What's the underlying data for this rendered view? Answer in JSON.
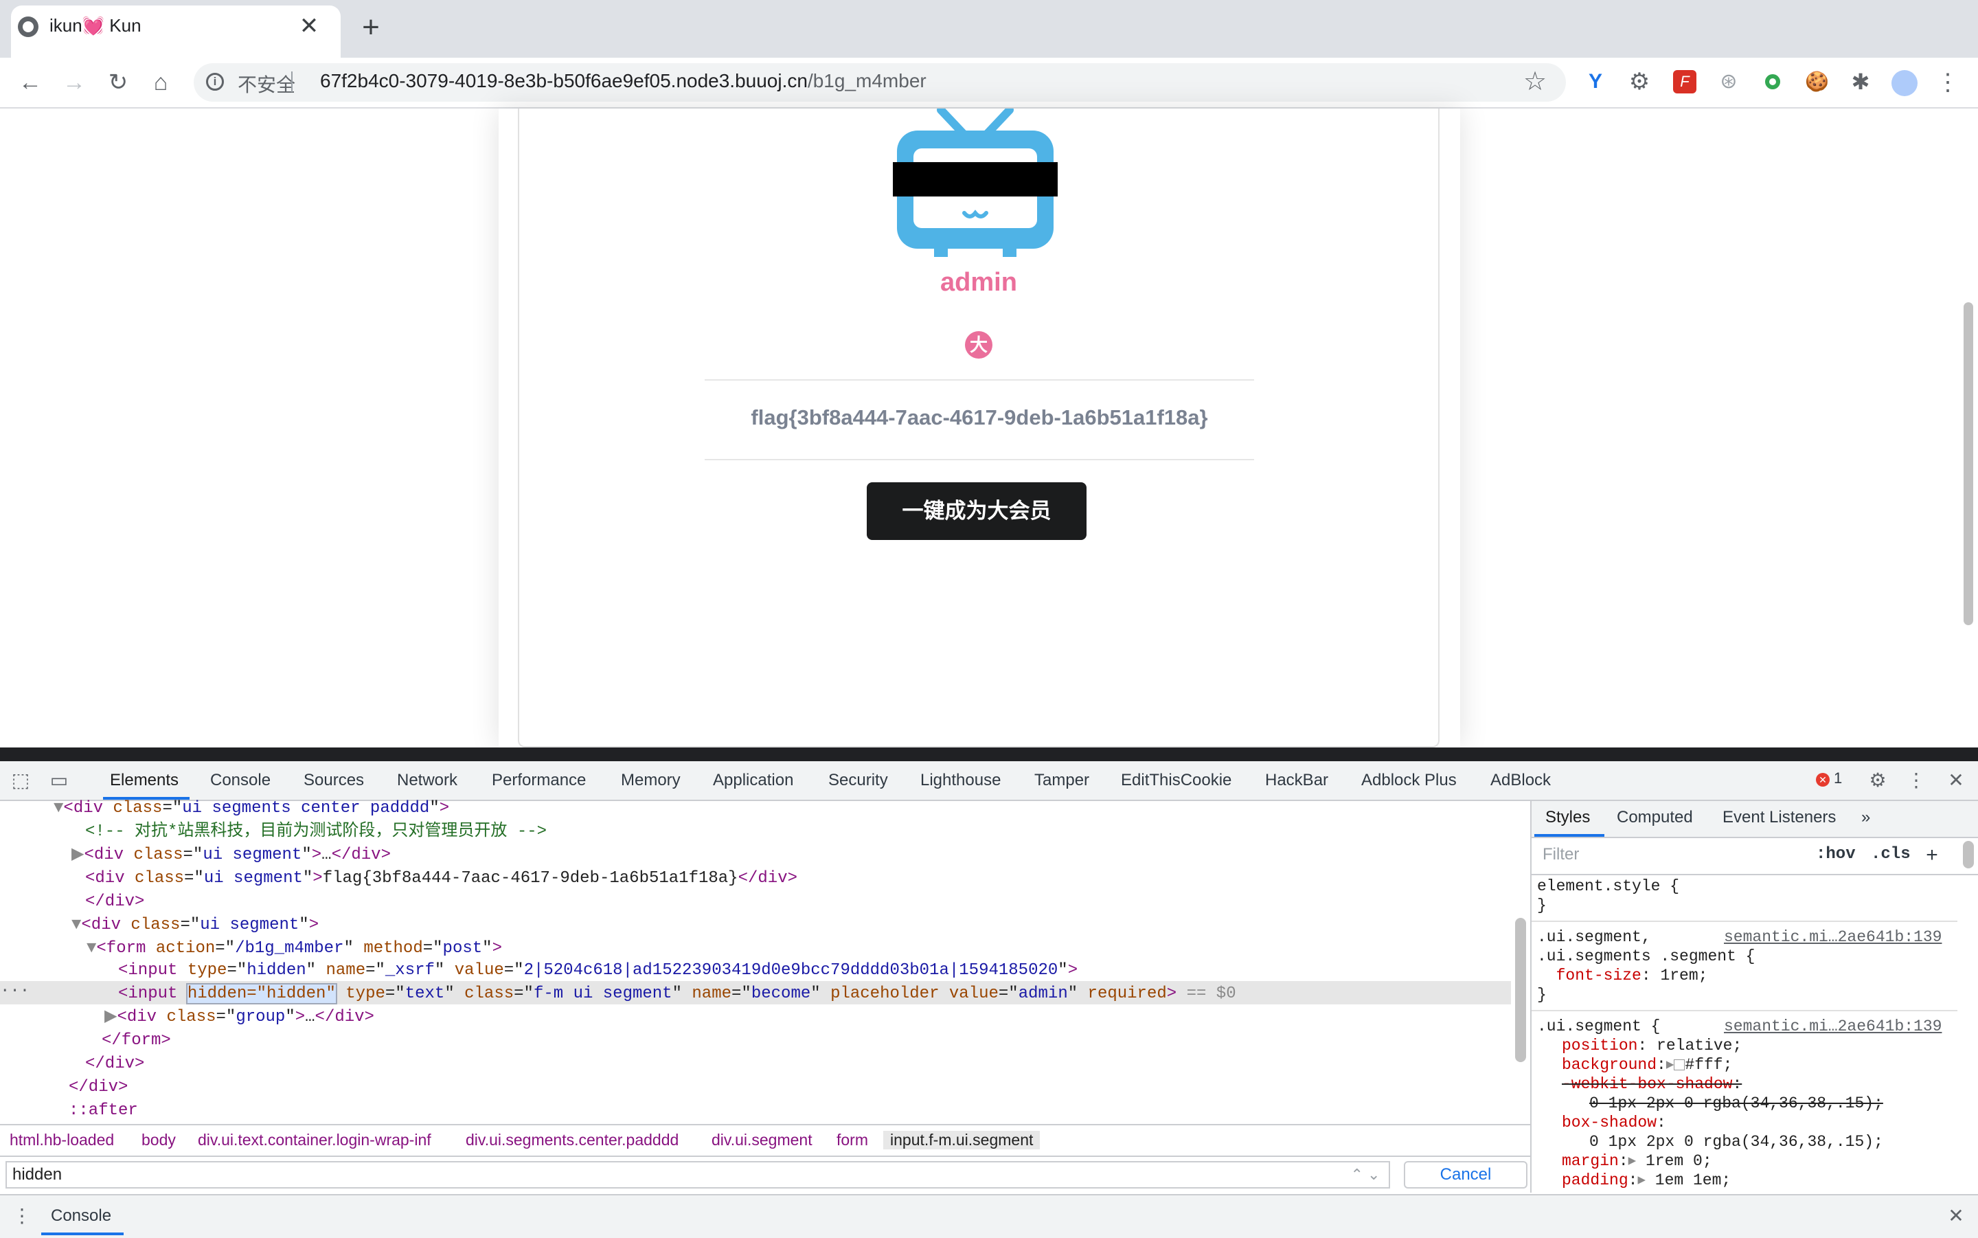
{
  "browser": {
    "tab_title": "ikun💓 Kun",
    "tab_close": "✕",
    "new_tab": "+",
    "insecure_label": "不安全",
    "url_host": "67f2b4c0-3079-4019-8e3b-b50f6ae9ef05.node3.buuoj.cn",
    "url_path": "/b1g_m4mber"
  },
  "page": {
    "username": "admin",
    "vip_badge": "大",
    "flag": "flag{3bf8a444-7aac-4617-9deb-1a6b51a1f18a}",
    "vip_button": "一键成为大会员"
  },
  "devtools": {
    "tabs": [
      "Elements",
      "Console",
      "Sources",
      "Network",
      "Performance",
      "Memory",
      "Application",
      "Security",
      "Lighthouse",
      "Tamper",
      "EditThisCookie",
      "HackBar",
      "Adblock Plus",
      "AdBlock"
    ],
    "error_count": "1",
    "dom": {
      "l1_tag": "div",
      "l1_cls": "ui segments center padddd",
      "l2_comment": "<!-- 对抗*站黑科技，目前为测试阶段，只对管理员开放 -->",
      "l3_cls": "ui segment",
      "l3_ellipsis": "…",
      "l4_cls": "ui segment",
      "l4_text": "flag{3bf8a444-7aac-4617-9deb-1a6b51a1f18a}",
      "l6_cls": "ui segment",
      "l7_action": "/b1g_m4mber",
      "l7_method": "post",
      "l8_type": "hidden",
      "l8_name": "_xsrf",
      "l8_value": "2|5204c618|ad15223903419d0e9bcc79dddd03b01a|1594185020",
      "l9_hidden": "hidden=\"hidden\"",
      "l9_type": "text",
      "l9_class": "f-m ui segment",
      "l9_name": "become",
      "l9_value": "admin",
      "l9_suffix": "== $0",
      "l10_cls": "group",
      "l14": "::after"
    },
    "breadcrumbs": [
      "html.hb-loaded",
      "body",
      "div.ui.text.container.login-wrap-inf",
      "div.ui.segments.center.padddd",
      "div.ui.segment",
      "form",
      "input.f-m.ui.segment"
    ],
    "search_value": "hidden",
    "cancel_label": "Cancel",
    "styles_tabs": [
      "Styles",
      "Computed",
      "Event Listeners"
    ],
    "filter_placeholder": "Filter",
    "hov": ":hov",
    "cls": ".cls",
    "styles": {
      "element_style": "element.style {",
      "close": "}",
      "r1_sel1": ".ui.segment,",
      "r1_sel2": ".ui.segments .segment {",
      "r1_src": "semantic.mi…2ae641b:139",
      "r1_prop": "font-size",
      "r1_val": "1rem;",
      "r2_sel": ".ui.segment {",
      "r2_src": "semantic.mi…2ae641b:139",
      "r2_props": [
        {
          "p": "position",
          "v": "relative;"
        },
        {
          "p": "background",
          "v": "#fff;"
        },
        {
          "p": "-webkit-box-shadow",
          "v": ""
        },
        {
          "p": "",
          "v": "0 1px 2px 0 rgba(34,36,38,.15);"
        },
        {
          "p": "box-shadow",
          "v": ""
        },
        {
          "p": "",
          "v": "0 1px 2px 0 rgba(34,36,38,.15);"
        },
        {
          "p": "margin",
          "v": "1rem 0;"
        },
        {
          "p": "padding",
          "v": "1em 1em;"
        }
      ]
    },
    "drawer_tab": "Console"
  }
}
